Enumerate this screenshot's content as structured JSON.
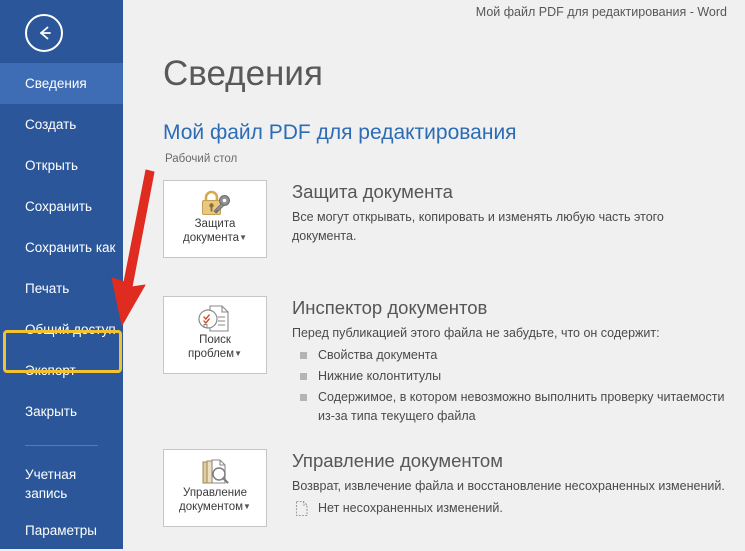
{
  "window": {
    "title": "Мой файл PDF для редактирования - Word"
  },
  "colors": {
    "sidebar_bg": "#2b579a",
    "sidebar_selected": "#3e6db5",
    "accent_link": "#2b6cb5",
    "highlight_border": "#f2c230",
    "annotation_arrow": "#e02b20",
    "content_bg": "#f0f0f0"
  },
  "sidebar": {
    "back_label": "Назад",
    "items": [
      {
        "label": "Сведения",
        "selected": true
      },
      {
        "label": "Создать",
        "selected": false
      },
      {
        "label": "Открыть",
        "selected": false
      },
      {
        "label": "Сохранить",
        "selected": false
      },
      {
        "label": "Сохранить как",
        "selected": false
      },
      {
        "label": "Печать",
        "selected": false
      },
      {
        "label": "Общий доступ",
        "selected": false
      },
      {
        "label": "Экспорт",
        "selected": false,
        "highlighted": true
      },
      {
        "label": "Закрыть",
        "selected": false
      }
    ],
    "footer_items": [
      {
        "label": "Учетная запись"
      },
      {
        "label": "Параметры"
      }
    ]
  },
  "main": {
    "page_title": "Сведения",
    "file_title": "Мой файл PDF для редактирования",
    "file_path": "Рабочий стол",
    "sections": [
      {
        "button_label_line1": "Защита",
        "button_label_line2": "документа",
        "icon": "lock-key-icon",
        "title": "Защита документа",
        "description": "Все могут открывать, копировать и изменять любую часть этого документа.",
        "bullets": [],
        "note": ""
      },
      {
        "button_label_line1": "Поиск",
        "button_label_line2": "проблем",
        "icon": "document-inspector-icon",
        "title": "Инспектор документов",
        "description": "Перед публикацией этого файла не забудьте, что он содержит:",
        "bullets": [
          "Свойства документа",
          "Нижние колонтитулы",
          "Содержимое, в котором невозможно выполнить проверку читаемости из-за типа текущего файла"
        ],
        "note": ""
      },
      {
        "button_label_line1": "Управление",
        "button_label_line2": "документом",
        "icon": "manage-document-icon",
        "title": "Управление документом",
        "description": "Возврат, извлечение файла и восстановление несохраненных изменений.",
        "bullets": [],
        "note": "Нет несохраненных изменений."
      }
    ]
  },
  "annotations": {
    "arrow": {
      "name": "red-arrow-pointer",
      "points_to": "Экспорт"
    },
    "highlight": {
      "name": "yellow-highlight-box",
      "target": "Экспорт"
    }
  }
}
